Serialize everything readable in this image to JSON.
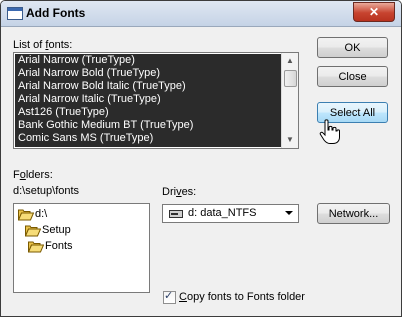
{
  "window": {
    "title": "Add Fonts",
    "close_glyph": "✕"
  },
  "fonts": {
    "label_pre": "List of ",
    "label_accel": "f",
    "label_post": "onts:",
    "items": [
      "Arial Narrow (TrueType)",
      "Arial Narrow Bold (TrueType)",
      "Arial Narrow Bold Italic (TrueType)",
      "Arial Narrow Italic (TrueType)",
      "Ast126 (TrueType)",
      "Bank Gothic Medium BT (TrueType)",
      "Comic Sans MS (TrueType)"
    ]
  },
  "buttons": {
    "ok": "OK",
    "close": "Close",
    "select_all": "Select All",
    "network": "Network..."
  },
  "folders": {
    "label_pre": "F",
    "label_accel": "o",
    "label_post": "lders:",
    "path": "d:\\setup\\fonts",
    "tree": [
      "d:\\",
      "Setup",
      "Fonts"
    ]
  },
  "drives": {
    "label_pre": "Dri",
    "label_accel": "v",
    "label_post": "es:",
    "selected": "d: data_NTFS"
  },
  "copy_option": {
    "accel": "C",
    "label_rest": "opy fonts to Fonts folder",
    "checked": true
  },
  "colors": {
    "selection_bg": "#2b2b2b",
    "dialog_bg": "#f0f0f0",
    "close_red": "#c7432f"
  }
}
